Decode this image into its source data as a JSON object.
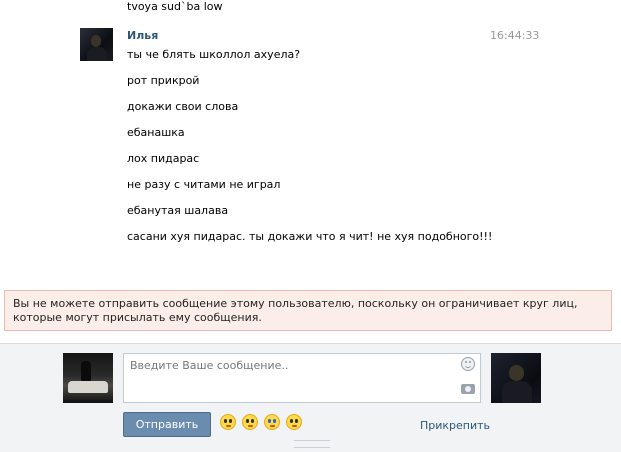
{
  "prev_message": "tvoya sud`ba low",
  "author": "Илья",
  "time": "16:44:33",
  "messages": [
    "ты че блять школлол ахуела?",
    "рот прикрой",
    "докажи свои слова",
    "ебанашка",
    "лох пидарас",
    "не разу с читами не играл",
    "ебанутая шалава",
    "сасани хуя пидарас. ты докажи что я чит! не хуя подобного!!!"
  ],
  "warning": "Вы не можете отправить сообщение этому пользователю, поскольку он ограничивает круг лиц, которые могут присылать ему сообщения.",
  "compose": {
    "placeholder": "Введите Ваше сообщение..",
    "send_label": "Отправить",
    "attach_label": "Прикрепить"
  },
  "icons": [
    "smile-icon",
    "camera-icon",
    "emoji-icons"
  ]
}
